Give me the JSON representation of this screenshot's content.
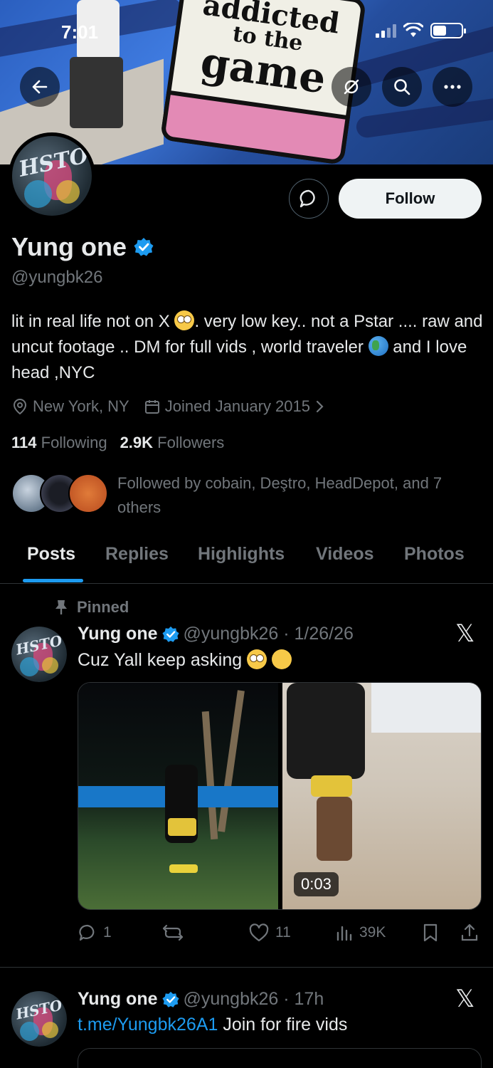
{
  "status_bar": {
    "time": "7:01"
  },
  "banner": {
    "graffiti_line1": "addicted",
    "graffiti_line2": "to the",
    "graffiti_line3": "game"
  },
  "profile": {
    "name": "Yung one",
    "handle": "@yungbk26",
    "bio_part1": "lit in real life not on X ",
    "bio_part2": ". very low key.. not a Pstar .... raw and uncut footage .. DM for full vids , world traveler ",
    "bio_part3": " and I love head ,NYC",
    "location": "New York, NY",
    "joined": "Joined January 2015",
    "following_count": "114",
    "following_label": "Following",
    "followers_count": "2.9K",
    "followers_label": "Followers",
    "followed_by": "Followed by cobain, Deştro, HeadDepot, and 7 others"
  },
  "actions": {
    "follow_label": "Follow"
  },
  "tabs": [
    {
      "label": "Posts"
    },
    {
      "label": "Replies"
    },
    {
      "label": "Highlights"
    },
    {
      "label": "Videos"
    },
    {
      "label": "Photos"
    }
  ],
  "posts": [
    {
      "pinned_label": "Pinned",
      "name": "Yung one",
      "handle_time": "@yungbk26 · 1/26/26",
      "text": "Cuz Yall  keep asking ",
      "video_duration": "0:03",
      "replies": "1",
      "reposts": "",
      "likes": "11",
      "views": "39K"
    },
    {
      "name": "Yung one",
      "handle_time": "@yungbk26 · 17h",
      "link": "t.me/Yungbk26A1",
      "text": " Join for fire vids"
    }
  ],
  "colors": {
    "accent": "#1d9bf0",
    "background": "#000000",
    "muted": "#71767b",
    "text": "#e7e9ea"
  }
}
